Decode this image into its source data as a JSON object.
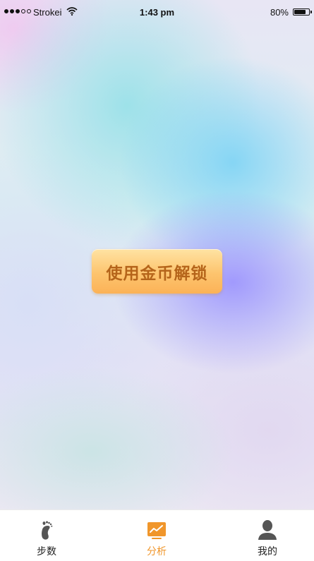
{
  "status_bar": {
    "carrier": "Strokei",
    "time": "1:43 pm",
    "battery": "80%",
    "battery_level": 0.8,
    "signal_bars_filled": 3,
    "signal_bars_total": 5
  },
  "main": {
    "unlock_button_label": "使用金币解锁"
  },
  "tab_bar": {
    "accent_color": "#f0962b",
    "items": [
      {
        "label": "步数",
        "icon": "footprint-icon",
        "active": false
      },
      {
        "label": "分析",
        "icon": "chart-icon",
        "active": true
      },
      {
        "label": "我的",
        "icon": "person-icon",
        "active": false
      }
    ]
  }
}
